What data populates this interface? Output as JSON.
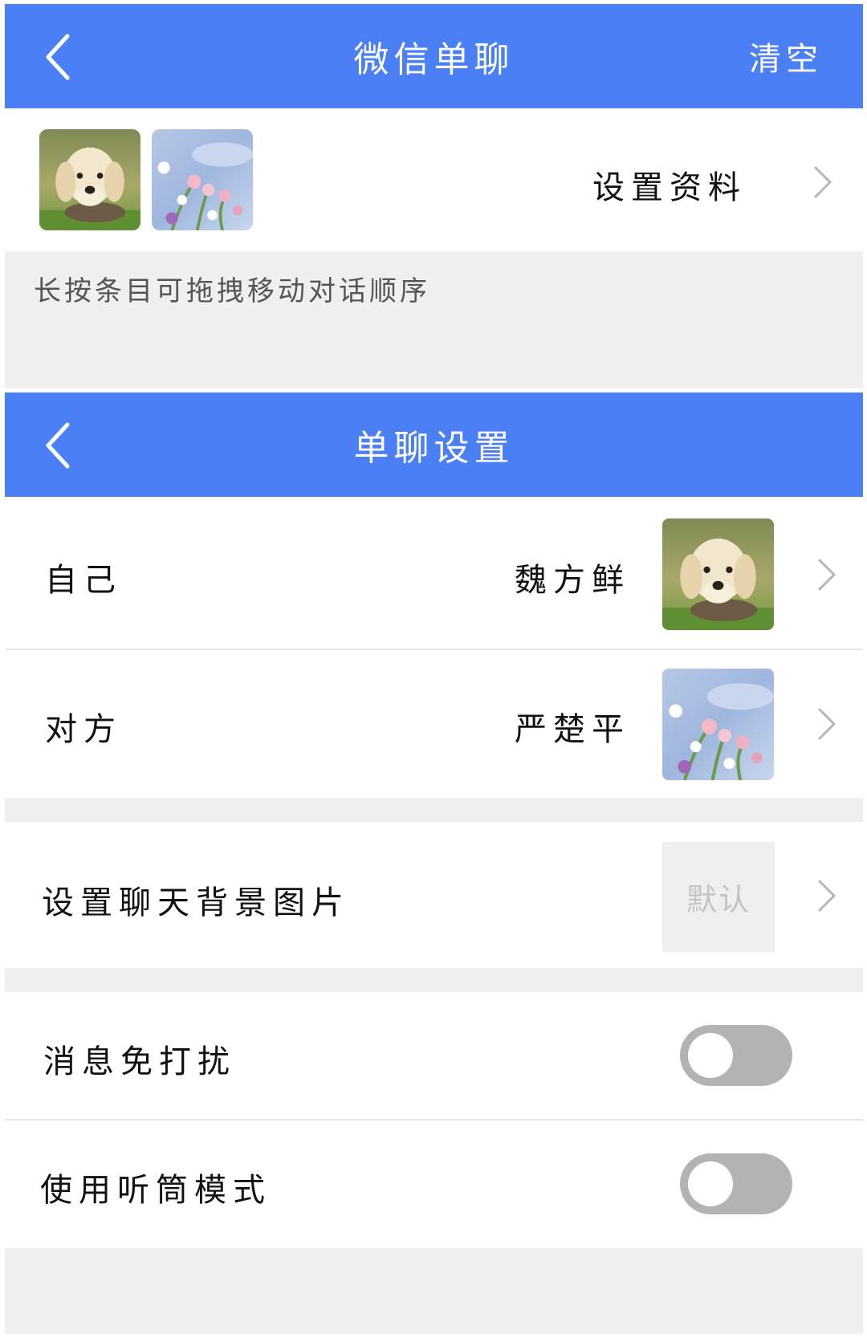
{
  "top_bar": {
    "title": "微信单聊",
    "right_action": "清空"
  },
  "preview": {
    "settings_link": "设置资料"
  },
  "hint": "长按条目可拖拽移动对话顺序",
  "settings_bar": {
    "title": "单聊设置"
  },
  "rows": {
    "self": {
      "label": "自己",
      "value": "魏方鲜"
    },
    "other": {
      "label": "对方",
      "value": "严楚平"
    },
    "background": {
      "label": "设置聊天背景图片",
      "value": "默认"
    },
    "mute": {
      "label": "消息免打扰",
      "on": false
    },
    "earpiece": {
      "label": "使用听筒模式",
      "on": false
    }
  },
  "colors": {
    "accent": "#4a7ff5",
    "section_gray": "#f0f0f0",
    "toggle_off": "#b3b3b3"
  }
}
